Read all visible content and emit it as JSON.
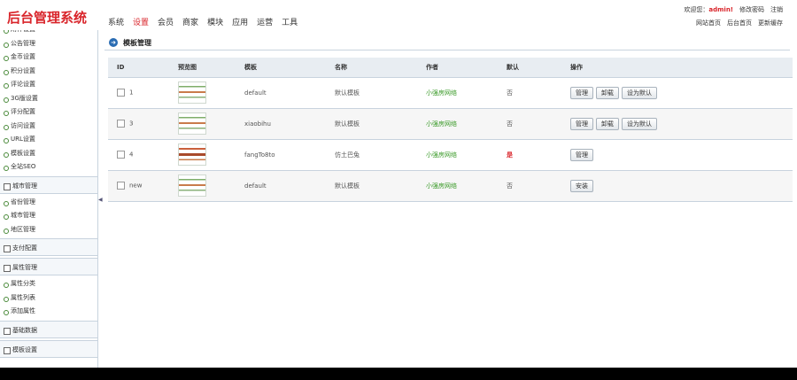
{
  "header": {
    "logo": "后台管理系统",
    "nav": [
      {
        "label": "系统",
        "active": false
      },
      {
        "label": "设置",
        "active": true
      },
      {
        "label": "会员",
        "active": false
      },
      {
        "label": "商家",
        "active": false
      },
      {
        "label": "模块",
        "active": false
      },
      {
        "label": "应用",
        "active": false
      },
      {
        "label": "运营",
        "active": false
      },
      {
        "label": "工具",
        "active": false
      }
    ],
    "welcome": "欢迎您：",
    "username": "admin!",
    "change_password": "修改密码",
    "logout": "注销",
    "site_home": "网站首页",
    "admin_home": "后台首页",
    "refresh_cache": "更新缓存"
  },
  "sidebar": {
    "sections": [
      {
        "type": "items",
        "items": [
          "附件设置",
          "公告管理",
          "金币设置",
          "积分设置",
          "评论设置",
          "3G版设置",
          "评分配置",
          "访问设置",
          "URL设置",
          "模板设置",
          "全站SEO"
        ]
      },
      {
        "type": "group",
        "label": "城市管理"
      },
      {
        "type": "items",
        "items": [
          "省份管理",
          "城市管理",
          "地区管理"
        ]
      },
      {
        "type": "group",
        "label": "支付配置"
      },
      {
        "type": "group",
        "label": "属性管理"
      },
      {
        "type": "items",
        "items": [
          "属性分类",
          "属性列表",
          "添加属性"
        ]
      },
      {
        "type": "group",
        "label": "基础数据"
      },
      {
        "type": "group",
        "label": "模板设置"
      }
    ]
  },
  "page": {
    "title": "模板管理"
  },
  "table": {
    "headers": [
      "ID",
      "预览图",
      "模板",
      "名称",
      "作者",
      "默认",
      "操作"
    ],
    "rows": [
      {
        "id": "1",
        "dir": "default",
        "name": "默认模板",
        "author": "小强房网络",
        "default": "否",
        "is_default": false,
        "actions": [
          "管理",
          "卸载",
          "设为默认"
        ],
        "thumb": "t1"
      },
      {
        "id": "3",
        "dir": "xiaobihu",
        "name": "默认模板",
        "author": "小强房网络",
        "default": "否",
        "is_default": false,
        "actions": [
          "管理",
          "卸载",
          "设为默认"
        ],
        "thumb": "t1"
      },
      {
        "id": "4",
        "dir": "fangTo8to",
        "name": "仿土巴兔",
        "author": "小强房网络",
        "default": "是",
        "is_default": true,
        "actions": [
          "管理"
        ],
        "thumb": "t3"
      },
      {
        "id": "new",
        "dir": "default",
        "name": "默认模板",
        "author": "小强房网络",
        "default": "否",
        "is_default": false,
        "actions": [
          "安装"
        ],
        "thumb": "t1"
      }
    ]
  }
}
